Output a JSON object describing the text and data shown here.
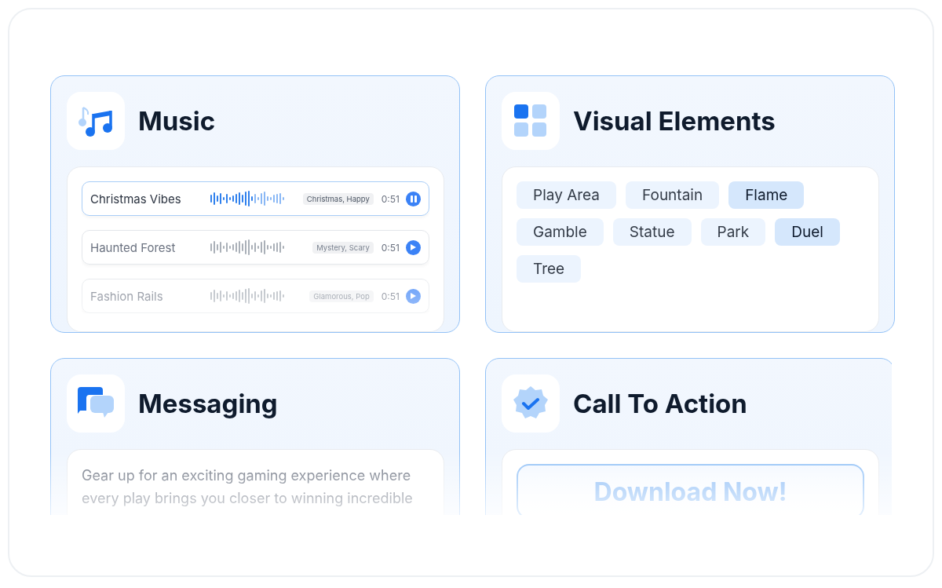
{
  "cards": [
    {
      "kind": "music",
      "title": "Music",
      "tracks": [
        {
          "name": "Christmas Vibes",
          "tags": "Christmas, Happy",
          "duration": "0:51",
          "playing": true
        },
        {
          "name": "Haunted Forest",
          "tags": "Mystery, Scary",
          "duration": "0:51",
          "playing": false
        },
        {
          "name": "Fashion Rails",
          "tags": "Glamorous, Pop",
          "duration": "0:51",
          "playing": false
        }
      ]
    },
    {
      "kind": "visual",
      "title": "Visual Elements",
      "chips": [
        {
          "label": "Play Area",
          "selected": false
        },
        {
          "label": "Fountain",
          "selected": false
        },
        {
          "label": "Flame",
          "selected": true
        },
        {
          "label": "Gamble",
          "selected": false
        },
        {
          "label": "Statue",
          "selected": false
        },
        {
          "label": "Park",
          "selected": false
        },
        {
          "label": "Duel",
          "selected": true
        },
        {
          "label": "Tree",
          "selected": false
        }
      ]
    },
    {
      "kind": "messaging",
      "title": "Messaging",
      "message": "Gear up for an exciting gaming experience where every play brings you closer to winning incredible"
    },
    {
      "kind": "cta",
      "title": "Call To Action",
      "button": "Download Now!"
    }
  ]
}
